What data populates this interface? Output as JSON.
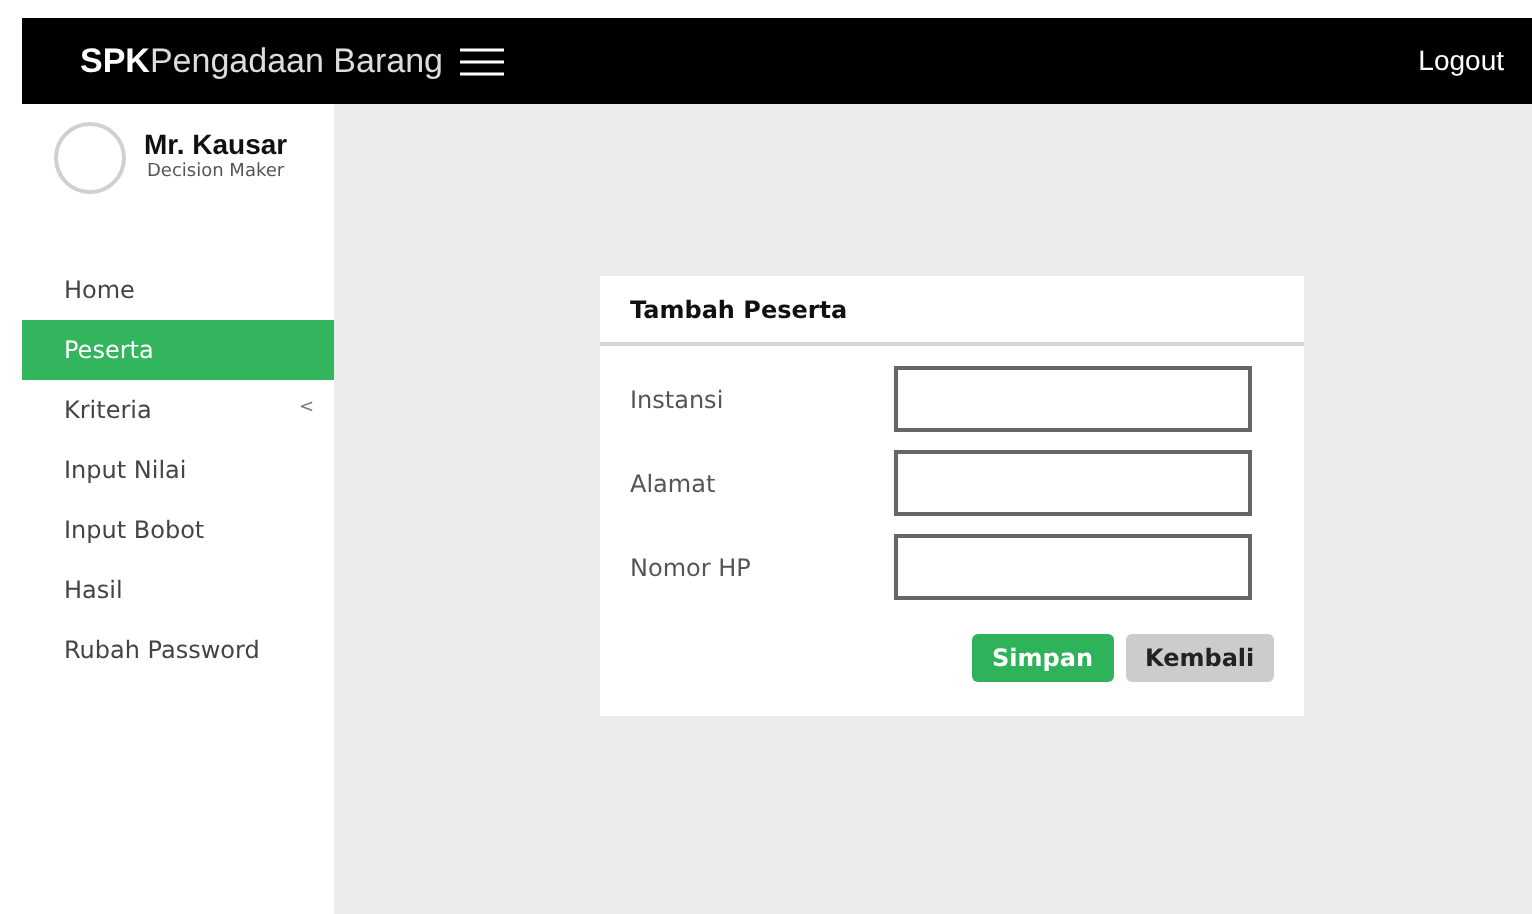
{
  "header": {
    "brand_bold": "SPK",
    "brand_rest": "Pengadaan Barang",
    "logout": "Logout"
  },
  "user": {
    "name": "Mr. Kausar",
    "role": "Decision Maker"
  },
  "sidebar": {
    "items": [
      {
        "label": "Home",
        "selected": false
      },
      {
        "label": "Peserta",
        "selected": true
      },
      {
        "label": "Kriteria",
        "selected": false,
        "caret": "<"
      },
      {
        "label": "Input Nilai",
        "selected": false
      },
      {
        "label": "Input Bobot",
        "selected": false
      },
      {
        "label": "Hasil",
        "selected": false
      },
      {
        "label": "Rubah Password",
        "selected": false
      }
    ]
  },
  "form": {
    "title": "Tambah Peserta",
    "fields": [
      {
        "label": "Instansi"
      },
      {
        "label": "Alamat"
      },
      {
        "label": "Nomor HP"
      }
    ],
    "buttons": [
      {
        "label": "Simpan",
        "kind": "primary"
      },
      {
        "label": "Kembali",
        "kind": "secondary"
      }
    ]
  }
}
